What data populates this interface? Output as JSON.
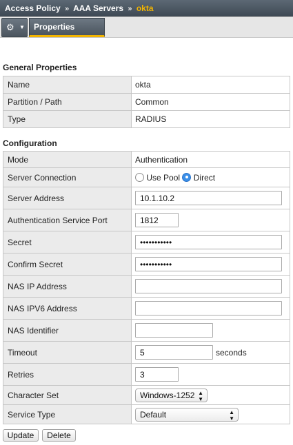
{
  "breadcrumb": {
    "items": [
      "Access Policy",
      "AAA Servers"
    ],
    "current": "okta",
    "separator": "»"
  },
  "toolbar": {
    "gear_icon": "⚙",
    "caret_icon": "▼",
    "tab_properties": "Properties"
  },
  "general": {
    "title": "General Properties",
    "rows": [
      {
        "label": "Name",
        "value": "okta"
      },
      {
        "label": "Partition / Path",
        "value": "Common"
      },
      {
        "label": "Type",
        "value": "RADIUS"
      }
    ]
  },
  "config": {
    "title": "Configuration",
    "mode": {
      "label": "Mode",
      "value": "Authentication"
    },
    "server_connection": {
      "label": "Server Connection",
      "option_pool": "Use Pool",
      "option_direct": "Direct",
      "selected": "Direct"
    },
    "server_address": {
      "label": "Server Address",
      "value": "10.1.10.2"
    },
    "auth_port": {
      "label": "Authentication Service Port",
      "value": "1812"
    },
    "secret": {
      "label": "Secret",
      "value": "•••••••••••"
    },
    "confirm_secret": {
      "label": "Confirm Secret",
      "value": "•••••••••••"
    },
    "nas_ip": {
      "label": "NAS IP Address",
      "value": ""
    },
    "nas_ipv6": {
      "label": "NAS IPV6 Address",
      "value": ""
    },
    "nas_identifier": {
      "label": "NAS Identifier",
      "value": ""
    },
    "timeout": {
      "label": "Timeout",
      "value": "5",
      "unit": "seconds"
    },
    "retries": {
      "label": "Retries",
      "value": "3"
    },
    "charset": {
      "label": "Character Set",
      "value": "Windows-1252"
    },
    "service_type": {
      "label": "Service Type",
      "value": "Default"
    }
  },
  "actions": {
    "update": "Update",
    "delete": "Delete"
  },
  "colors": {
    "accent": "#f2b400",
    "header_bg": "#4b555f",
    "label_bg": "#ebebeb",
    "radio_selected": "#3b8fe8"
  }
}
